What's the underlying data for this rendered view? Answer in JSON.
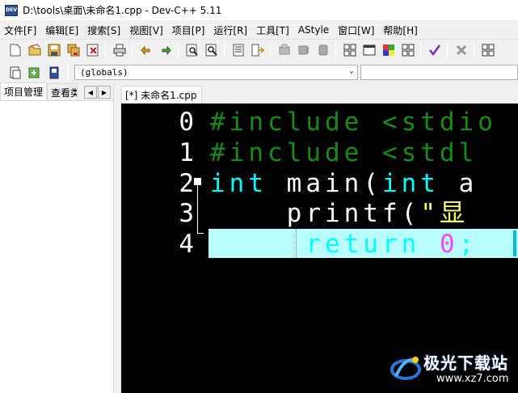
{
  "window": {
    "app_icon_text": "DEV",
    "title": "D:\\tools\\桌面\\未命名1.cpp - Dev-C++ 5.11"
  },
  "menu": {
    "items": [
      {
        "label": "文件[F]"
      },
      {
        "label": "编辑[E]"
      },
      {
        "label": "搜索[S]"
      },
      {
        "label": "视图[V]"
      },
      {
        "label": "项目[P]"
      },
      {
        "label": "运行[R]"
      },
      {
        "label": "工具[T]"
      },
      {
        "label": "AStyle"
      },
      {
        "label": "窗口[W]"
      },
      {
        "label": "帮助[H]"
      }
    ]
  },
  "toolbar2": {
    "scope_value": "(globals)"
  },
  "left_panel": {
    "tabs": [
      {
        "label": "项目管理"
      },
      {
        "label": "查看类"
      }
    ],
    "arrow_left": "◀",
    "arrow_right": "▶"
  },
  "editor": {
    "tab_label": "[*] 未命名1.cpp",
    "line_numbers": [
      "0",
      "1",
      "2",
      "3",
      "4"
    ],
    "lines": [
      {
        "tokens": [
          {
            "t": "#include <stdio",
            "c": "pre"
          }
        ]
      },
      {
        "tokens": [
          {
            "t": "#include <stdl",
            "c": "pre"
          }
        ]
      },
      {
        "tokens": [
          {
            "t": "int",
            "c": "kw"
          },
          {
            "t": " main(",
            "c": "id"
          },
          {
            "t": "int",
            "c": "kw"
          },
          {
            "t": " a",
            "c": "id"
          }
        ]
      },
      {
        "tokens": [
          {
            "t": "    printf(",
            "c": "id"
          },
          {
            "t": "\"显 ",
            "c": "str"
          }
        ]
      },
      {
        "tokens": [
          {
            "t": "     return ",
            "c": "kw"
          },
          {
            "t": "0",
            "c": "num"
          },
          {
            "t": ";",
            "c": "kw"
          }
        ]
      }
    ]
  },
  "watermark": {
    "title": "极光下载站",
    "url": "www.xz7.com"
  }
}
